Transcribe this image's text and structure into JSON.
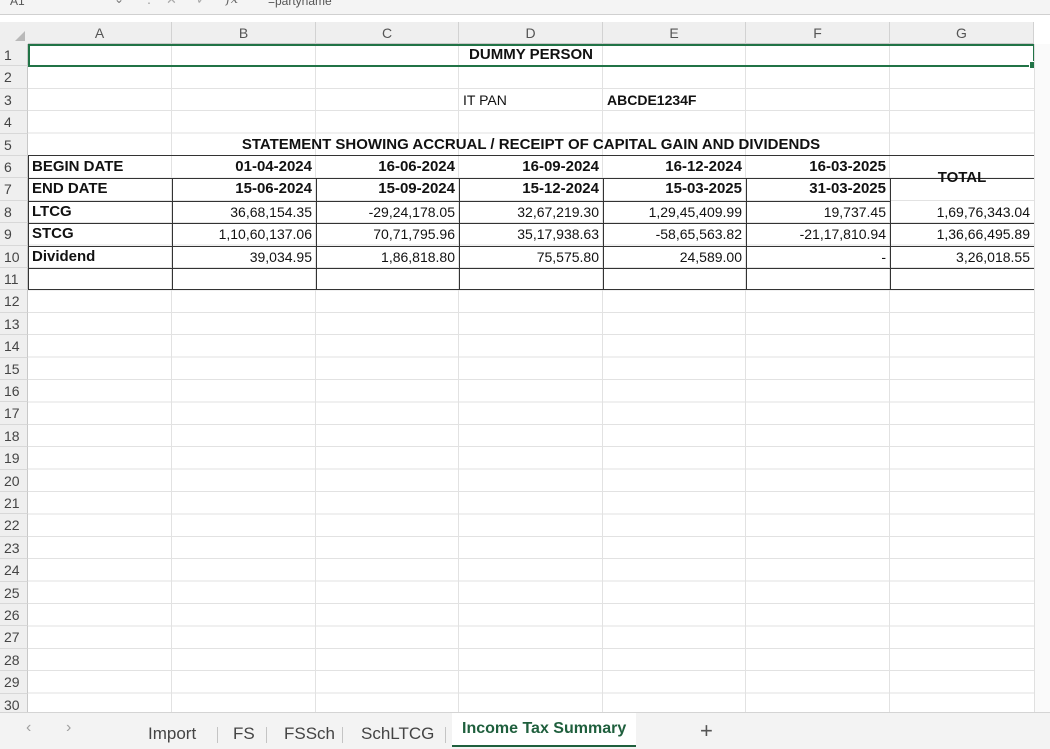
{
  "formula_bar": {
    "name_box": "A1",
    "formula": "=partyname"
  },
  "columns": [
    "A",
    "B",
    "C",
    "D",
    "E",
    "F",
    "G"
  ],
  "rows": [
    "1",
    "2",
    "3",
    "4",
    "5",
    "6",
    "7",
    "8",
    "9",
    "10",
    "11",
    "12",
    "13",
    "14",
    "15",
    "16",
    "17",
    "18",
    "19",
    "20",
    "21",
    "22",
    "23",
    "24",
    "25",
    "26",
    "27",
    "28",
    "29",
    "30"
  ],
  "sheet": {
    "title": "DUMMY PERSON",
    "pan_label": "IT PAN",
    "pan_value": "ABCDE1234F",
    "statement_title": "STATEMENT SHOWING ACCRUAL / RECEIPT OF CAPITAL GAIN AND DIVIDENDS",
    "begin_label": "BEGIN DATE",
    "end_label": "END DATE",
    "total_label": "TOTAL",
    "begin_dates": [
      "01-04-2024",
      "16-06-2024",
      "16-09-2024",
      "16-12-2024",
      "16-03-2025"
    ],
    "end_dates": [
      "15-06-2024",
      "15-09-2024",
      "15-12-2024",
      "15-03-2025",
      "31-03-2025"
    ],
    "data_rows": [
      {
        "label": "LTCG",
        "values": [
          "36,68,154.35",
          "-29,24,178.05",
          "32,67,219.30",
          "1,29,45,409.99",
          "19,737.45"
        ],
        "total": "1,69,76,343.04"
      },
      {
        "label": "STCG",
        "values": [
          "1,10,60,137.06",
          "70,71,795.96",
          "35,17,938.63",
          "-58,65,563.82",
          "-21,17,810.94"
        ],
        "total": "1,36,66,495.89"
      },
      {
        "label": "Dividend",
        "values": [
          "39,034.95",
          "1,86,818.80",
          "75,575.80",
          "24,589.00",
          "-"
        ],
        "total": "3,26,018.55"
      }
    ]
  },
  "tabs": {
    "items": [
      "Import",
      "FS",
      "FSSch",
      "SchLTCG",
      "Income Tax Summary"
    ],
    "active": "Income Tax Summary",
    "add_label": "+"
  }
}
